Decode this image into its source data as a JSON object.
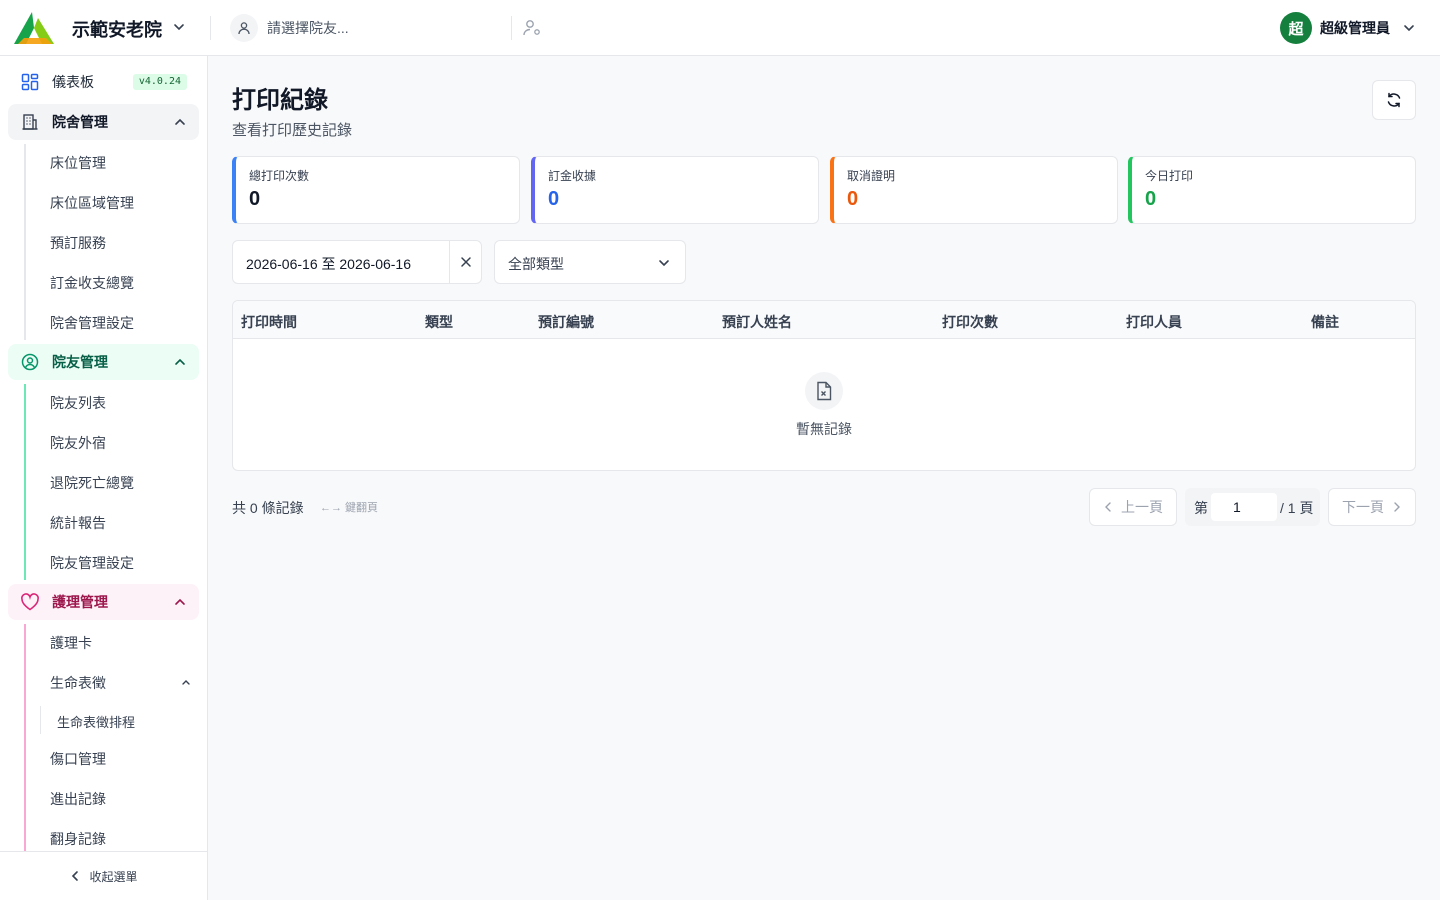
{
  "header": {
    "org_name": "示範安老院",
    "resident_placeholder": "請選擇院友...",
    "user_initial": "超",
    "user_name": "超級管理員"
  },
  "sidebar": {
    "dashboard": {
      "label": "儀表板",
      "version": "v4.0.24"
    },
    "house_group": {
      "label": "院舍管理",
      "items": [
        "床位管理",
        "床位區域管理",
        "預訂服務",
        "訂金收支總覽",
        "院舍管理設定"
      ]
    },
    "resident_group": {
      "label": "院友管理",
      "items": [
        "院友列表",
        "院友外宿",
        "退院死亡總覽",
        "統計報告",
        "院友管理設定"
      ]
    },
    "care_group": {
      "label": "護理管理",
      "items": [
        "護理卡",
        "生命表徵",
        "傷口管理",
        "進出記錄",
        "翻身記錄"
      ],
      "vitals_subitem": "生命表徵排程"
    },
    "collapse_label": "收起選單"
  },
  "page": {
    "title": "打印紀錄",
    "subtitle": "查看打印歷史記錄"
  },
  "stats": [
    {
      "label": "總打印次數",
      "value": "0",
      "color": "#3b82f6",
      "value_color": "#111827"
    },
    {
      "label": "訂金收據",
      "value": "0",
      "color": "#6366f1",
      "value_color": "#2563eb"
    },
    {
      "label": "取消證明",
      "value": "0",
      "color": "#f97316",
      "value_color": "#ea580c"
    },
    {
      "label": "今日打印",
      "value": "0",
      "color": "#22c55e",
      "value_color": "#16a34a"
    }
  ],
  "filters": {
    "date_range": "2026-06-16 至 2026-06-16",
    "type_value": "全部類型"
  },
  "table": {
    "columns": [
      "打印時間",
      "類型",
      "預訂編號",
      "預訂人姓名",
      "打印次數",
      "打印人員",
      "備註"
    ],
    "empty_text": "暫無記錄"
  },
  "footer": {
    "total_text": "共 0 條記錄",
    "kbd_hint": "←→ 鍵翻頁",
    "prev_label": "上一頁",
    "page_prefix": "第",
    "page_value": "1",
    "page_suffix": "/ 1 頁",
    "next_label": "下一頁"
  }
}
